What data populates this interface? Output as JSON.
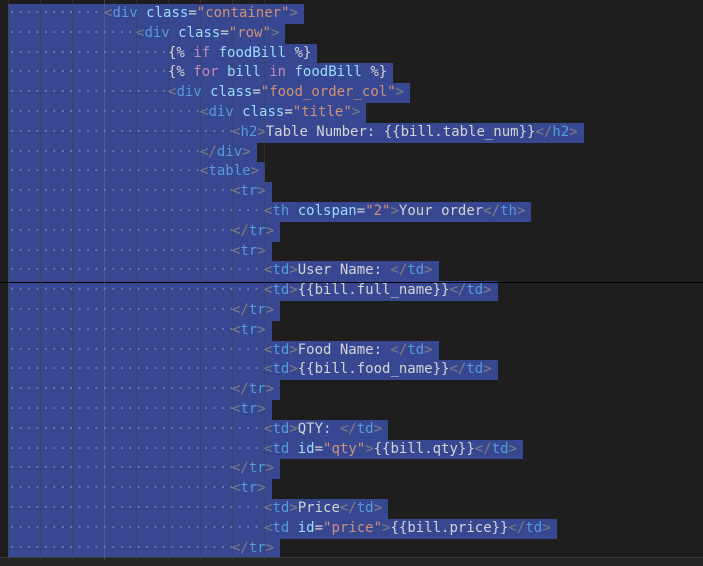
{
  "editor": {
    "colors": {
      "background": "#1e1e1e",
      "selection": "#3a4b9b",
      "tag": "#569cd6",
      "attribute": "#9cdcfe",
      "string": "#ce9178",
      "keyword": "#c586c0",
      "text": "#d4d4d4"
    },
    "lines": [
      {
        "indent": 3,
        "tokens": [
          [
            "t-punc",
            "<"
          ],
          [
            "t-tag",
            "div"
          ],
          [
            "t-text",
            " "
          ],
          [
            "t-attr",
            "class"
          ],
          [
            "t-text",
            "="
          ],
          [
            "t-str",
            "\"container\""
          ],
          [
            "t-punc",
            ">"
          ]
        ]
      },
      {
        "indent": 4,
        "tokens": [
          [
            "t-punc",
            "<"
          ],
          [
            "t-tag",
            "div"
          ],
          [
            "t-text",
            " "
          ],
          [
            "t-attr",
            "class"
          ],
          [
            "t-text",
            "="
          ],
          [
            "t-str",
            "\"row\""
          ],
          [
            "t-punc",
            ">"
          ]
        ]
      },
      {
        "indent": 5,
        "tokens": [
          [
            "t-brace",
            "{% "
          ],
          [
            "t-kw",
            "if"
          ],
          [
            "t-text",
            " "
          ],
          [
            "t-var",
            "foodBill"
          ],
          [
            "t-brace",
            " %}"
          ]
        ]
      },
      {
        "indent": 5,
        "tokens": [
          [
            "t-brace",
            "{% "
          ],
          [
            "t-kw",
            "for"
          ],
          [
            "t-text",
            " "
          ],
          [
            "t-var",
            "bill"
          ],
          [
            "t-text",
            " "
          ],
          [
            "t-kw",
            "in"
          ],
          [
            "t-text",
            " "
          ],
          [
            "t-var",
            "foodBill"
          ],
          [
            "t-brace",
            " %}"
          ]
        ]
      },
      {
        "indent": 5,
        "tokens": [
          [
            "t-punc",
            "<"
          ],
          [
            "t-tag",
            "div"
          ],
          [
            "t-text",
            " "
          ],
          [
            "t-attr",
            "class"
          ],
          [
            "t-text",
            "="
          ],
          [
            "t-str",
            "\"food_order_col\""
          ],
          [
            "t-punc",
            ">"
          ]
        ]
      },
      {
        "indent": 6,
        "tokens": [
          [
            "t-punc",
            "<"
          ],
          [
            "t-tag",
            "div"
          ],
          [
            "t-text",
            " "
          ],
          [
            "t-attr",
            "class"
          ],
          [
            "t-text",
            "="
          ],
          [
            "t-str",
            "\"title\""
          ],
          [
            "t-punc",
            ">"
          ]
        ]
      },
      {
        "indent": 7,
        "tokens": [
          [
            "t-punc",
            "<"
          ],
          [
            "t-tag",
            "h2"
          ],
          [
            "t-punc",
            ">"
          ],
          [
            "t-text",
            "Table Number: {{bill.table_num}}"
          ],
          [
            "t-punc",
            "</"
          ],
          [
            "t-tag",
            "h2"
          ],
          [
            "t-punc",
            ">"
          ]
        ]
      },
      {
        "indent": 6,
        "tokens": [
          [
            "t-punc",
            "</"
          ],
          [
            "t-tag",
            "div"
          ],
          [
            "t-punc",
            ">"
          ]
        ]
      },
      {
        "indent": 6,
        "tokens": [
          [
            "t-punc",
            "<"
          ],
          [
            "t-tag",
            "table"
          ],
          [
            "t-punc",
            ">"
          ]
        ]
      },
      {
        "indent": 7,
        "tokens": [
          [
            "t-punc",
            "<"
          ],
          [
            "t-tag",
            "tr"
          ],
          [
            "t-punc",
            ">"
          ]
        ]
      },
      {
        "indent": 8,
        "tokens": [
          [
            "t-punc",
            "<"
          ],
          [
            "t-tag",
            "th"
          ],
          [
            "t-text",
            " "
          ],
          [
            "t-attr",
            "colspan"
          ],
          [
            "t-text",
            "="
          ],
          [
            "t-str",
            "\"2\""
          ],
          [
            "t-punc",
            ">"
          ],
          [
            "t-text",
            "Your order"
          ],
          [
            "t-punc",
            "</"
          ],
          [
            "t-tag",
            "th"
          ],
          [
            "t-punc",
            ">"
          ]
        ]
      },
      {
        "indent": 7,
        "tokens": [
          [
            "t-punc",
            "</"
          ],
          [
            "t-tag",
            "tr"
          ],
          [
            "t-punc",
            ">"
          ]
        ]
      },
      {
        "indent": 7,
        "tokens": [
          [
            "t-punc",
            "<"
          ],
          [
            "t-tag",
            "tr"
          ],
          [
            "t-punc",
            ">"
          ]
        ]
      },
      {
        "indent": 8,
        "tokens": [
          [
            "t-punc",
            "<"
          ],
          [
            "t-tag",
            "td"
          ],
          [
            "t-punc",
            ">"
          ],
          [
            "t-text",
            "User Name: "
          ],
          [
            "t-punc",
            "</"
          ],
          [
            "t-tag",
            "td"
          ],
          [
            "t-punc",
            ">"
          ]
        ]
      },
      {
        "indent": 8,
        "tokens": [
          [
            "t-punc",
            "<"
          ],
          [
            "t-tag",
            "td"
          ],
          [
            "t-punc",
            ">"
          ],
          [
            "t-text",
            "{{bill.full_name}}"
          ],
          [
            "t-punc",
            "</"
          ],
          [
            "t-tag",
            "td"
          ],
          [
            "t-punc",
            ">"
          ]
        ]
      },
      {
        "indent": 7,
        "tokens": [
          [
            "t-punc",
            "</"
          ],
          [
            "t-tag",
            "tr"
          ],
          [
            "t-punc",
            ">"
          ]
        ]
      },
      {
        "indent": 7,
        "tokens": [
          [
            "t-punc",
            "<"
          ],
          [
            "t-tag",
            "tr"
          ],
          [
            "t-punc",
            ">"
          ]
        ]
      },
      {
        "indent": 8,
        "tokens": [
          [
            "t-punc",
            "<"
          ],
          [
            "t-tag",
            "td"
          ],
          [
            "t-punc",
            ">"
          ],
          [
            "t-text",
            "Food Name: "
          ],
          [
            "t-punc",
            "</"
          ],
          [
            "t-tag",
            "td"
          ],
          [
            "t-punc",
            ">"
          ]
        ]
      },
      {
        "indent": 8,
        "tokens": [
          [
            "t-punc",
            "<"
          ],
          [
            "t-tag",
            "td"
          ],
          [
            "t-punc",
            ">"
          ],
          [
            "t-text",
            "{{bill.food_name}}"
          ],
          [
            "t-punc",
            "</"
          ],
          [
            "t-tag",
            "td"
          ],
          [
            "t-punc",
            ">"
          ]
        ]
      },
      {
        "indent": 7,
        "tokens": [
          [
            "t-punc",
            "</"
          ],
          [
            "t-tag",
            "tr"
          ],
          [
            "t-punc",
            ">"
          ]
        ]
      },
      {
        "indent": 7,
        "tokens": [
          [
            "t-punc",
            "<"
          ],
          [
            "t-tag",
            "tr"
          ],
          [
            "t-punc",
            ">"
          ]
        ]
      },
      {
        "indent": 8,
        "tokens": [
          [
            "t-punc",
            "<"
          ],
          [
            "t-tag",
            "td"
          ],
          [
            "t-punc",
            ">"
          ],
          [
            "t-text",
            "QTY: "
          ],
          [
            "t-punc",
            "</"
          ],
          [
            "t-tag",
            "td"
          ],
          [
            "t-punc",
            ">"
          ]
        ]
      },
      {
        "indent": 8,
        "tokens": [
          [
            "t-punc",
            "<"
          ],
          [
            "t-tag",
            "td"
          ],
          [
            "t-text",
            " "
          ],
          [
            "t-attr",
            "id"
          ],
          [
            "t-text",
            "="
          ],
          [
            "t-str",
            "\"qty\""
          ],
          [
            "t-punc",
            ">"
          ],
          [
            "t-text",
            "{{bill.qty}}"
          ],
          [
            "t-punc",
            "</"
          ],
          [
            "t-tag",
            "td"
          ],
          [
            "t-punc",
            ">"
          ]
        ]
      },
      {
        "indent": 7,
        "tokens": [
          [
            "t-punc",
            "</"
          ],
          [
            "t-tag",
            "tr"
          ],
          [
            "t-punc",
            ">"
          ]
        ]
      },
      {
        "indent": 7,
        "tokens": [
          [
            "t-punc",
            "<"
          ],
          [
            "t-tag",
            "tr"
          ],
          [
            "t-punc",
            ">"
          ]
        ]
      },
      {
        "indent": 8,
        "tokens": [
          [
            "t-punc",
            "<"
          ],
          [
            "t-tag",
            "td"
          ],
          [
            "t-punc",
            ">"
          ],
          [
            "t-text",
            "Price"
          ],
          [
            "t-punc",
            "</"
          ],
          [
            "t-tag",
            "td"
          ],
          [
            "t-punc",
            ">"
          ]
        ]
      },
      {
        "indent": 8,
        "tokens": [
          [
            "t-punc",
            "<"
          ],
          [
            "t-tag",
            "td"
          ],
          [
            "t-text",
            " "
          ],
          [
            "t-attr",
            "id"
          ],
          [
            "t-text",
            "="
          ],
          [
            "t-str",
            "\"price\""
          ],
          [
            "t-punc",
            ">"
          ],
          [
            "t-text",
            "{{bill.price}}"
          ],
          [
            "t-punc",
            "</"
          ],
          [
            "t-tag",
            "td"
          ],
          [
            "t-punc",
            ">"
          ]
        ]
      },
      {
        "indent": 7,
        "tokens": [
          [
            "t-punc",
            "</"
          ],
          [
            "t-tag",
            "tr"
          ],
          [
            "t-punc",
            ">"
          ]
        ]
      }
    ]
  }
}
